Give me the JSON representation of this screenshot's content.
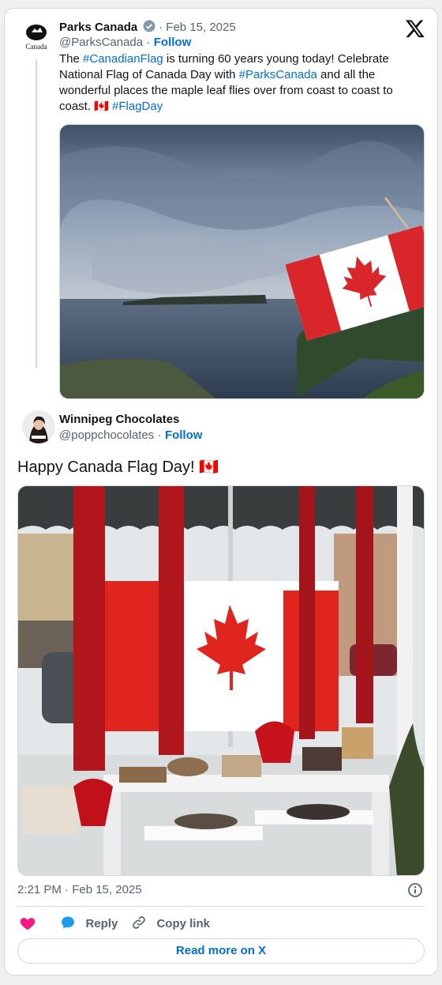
{
  "x_logo": "𝕏",
  "quoted": {
    "author_name": "Parks Canada",
    "handle": "@ParksCanada",
    "date_sep": "· Feb 15, 2025",
    "follow": "Follow",
    "text_parts": [
      {
        "t": "The ",
        "link": false
      },
      {
        "t": "#CanadianFlag",
        "link": true
      },
      {
        "t": " is turning 60 years young today! Celebrate National Flag of Canada Day with ",
        "link": false
      },
      {
        "t": "#ParksCanada",
        "link": true
      },
      {
        "t": " and all the wonderful places the maple leaf flies over from coast to coast to coast. 🇨🇦 ",
        "link": false
      },
      {
        "t": "#FlagDay",
        "link": true
      }
    ],
    "avatar_logo_text": "Canada"
  },
  "main": {
    "author_name": "Winnipeg Chocolates",
    "handle": "@poppchocolates",
    "follow": "Follow",
    "text": "Happy Canada Flag Day! 🇨🇦",
    "timestamp": "2:21 PM · Feb 15, 2025"
  },
  "actions": {
    "reply": "Reply",
    "copy_link": "Copy link",
    "read_more": "Read more on X"
  },
  "colors": {
    "link": "#006fd6",
    "like": "#f91880",
    "flag_red": "#e0241e"
  }
}
